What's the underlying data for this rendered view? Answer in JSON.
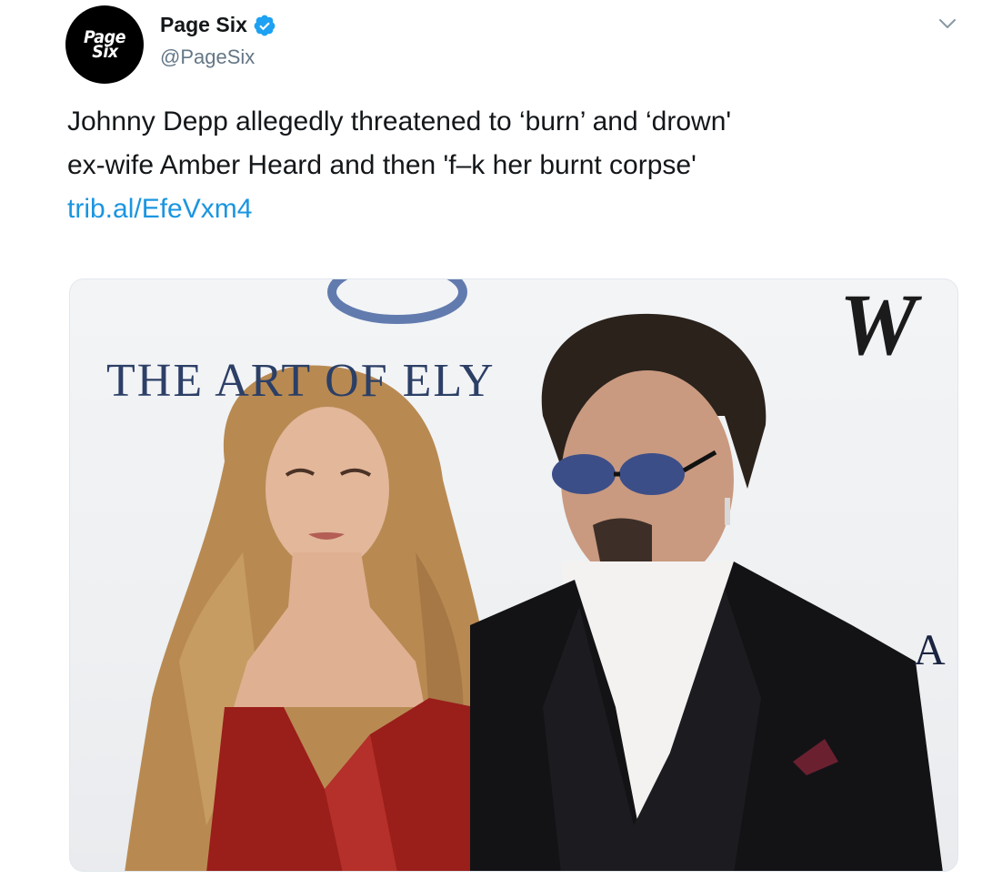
{
  "account": {
    "avatar_text_line1": "Page",
    "avatar_text_line2": "Six",
    "display_name": "Page Six",
    "handle": "@PageSix",
    "verified": true
  },
  "icons": {
    "verified": "verified-badge-icon",
    "menu": "chevron-down-icon"
  },
  "tweet": {
    "line1": "Johnny Depp allegedly threatened to ‘burn’ and ‘drown'",
    "line2": "ex-wife Amber Heard and then 'f–k her burnt corpse'",
    "link": "trib.al/EfeVxm4"
  },
  "media": {
    "backdrop_text_1": "THE ART OF ELY",
    "backdrop_text_2": "A",
    "backdrop_text_3": "W"
  },
  "colors": {
    "link": "#1b95e0",
    "verified": "#1da1f2",
    "secondary_text": "#657786",
    "dress": "#9a1e1a",
    "suit": "#121214"
  }
}
